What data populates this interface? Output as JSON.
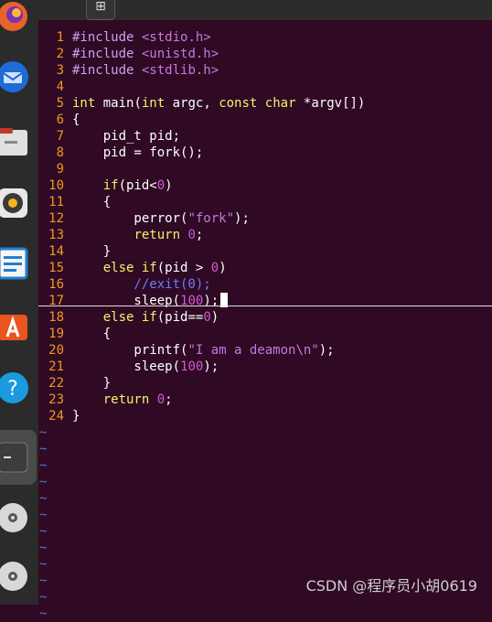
{
  "dock": {
    "items": [
      "firefox-icon",
      "thunderbird-icon",
      "files-icon",
      "rhythmbox-icon",
      "writer-icon",
      "software-icon",
      "help-icon",
      "terminal-icon",
      "dvd-icon",
      "dvd-icon-2"
    ]
  },
  "topbar": {
    "new_tab_label": "⊞"
  },
  "editor": {
    "lines": [
      {
        "n": "1",
        "code": "#include <stdio.h>"
      },
      {
        "n": "2",
        "code": "#include <unistd.h>"
      },
      {
        "n": "3",
        "code": "#include <stdlib.h>"
      },
      {
        "n": "4",
        "code": ""
      },
      {
        "n": "5",
        "code": "int main(int argc, const char *argv[])"
      },
      {
        "n": "6",
        "code": "{"
      },
      {
        "n": "7",
        "code": "    pid_t pid;"
      },
      {
        "n": "8",
        "code": "    pid = fork();"
      },
      {
        "n": "9",
        "code": ""
      },
      {
        "n": "10",
        "code": "    if(pid<0)"
      },
      {
        "n": "11",
        "code": "    {"
      },
      {
        "n": "12",
        "code": "        perror(\"fork\");"
      },
      {
        "n": "13",
        "code": "        return 0;"
      },
      {
        "n": "14",
        "code": "    }"
      },
      {
        "n": "15",
        "code": "    else if(pid > 0)"
      },
      {
        "n": "16",
        "code": "        //exit(0);"
      },
      {
        "n": "17",
        "code": "        sleep(100);"
      },
      {
        "n": "18",
        "code": "    else if(pid==0)"
      },
      {
        "n": "19",
        "code": "    {"
      },
      {
        "n": "20",
        "code": "        printf(\"I am a deamon\\n\");"
      },
      {
        "n": "21",
        "code": "        sleep(100);"
      },
      {
        "n": "22",
        "code": "    }"
      },
      {
        "n": "23",
        "code": "    return 0;"
      },
      {
        "n": "24",
        "code": "}"
      }
    ],
    "tilde": "~",
    "tilde_count": 12
  },
  "watermark": "CSDN @程序员小胡0619",
  "colors": {
    "background": "#300a24",
    "line_number": "#ef9a1d",
    "keyword": "#f2f56a",
    "string": "#c678dd",
    "comment": "#6b7cff",
    "tilde": "#4b7bd8"
  }
}
